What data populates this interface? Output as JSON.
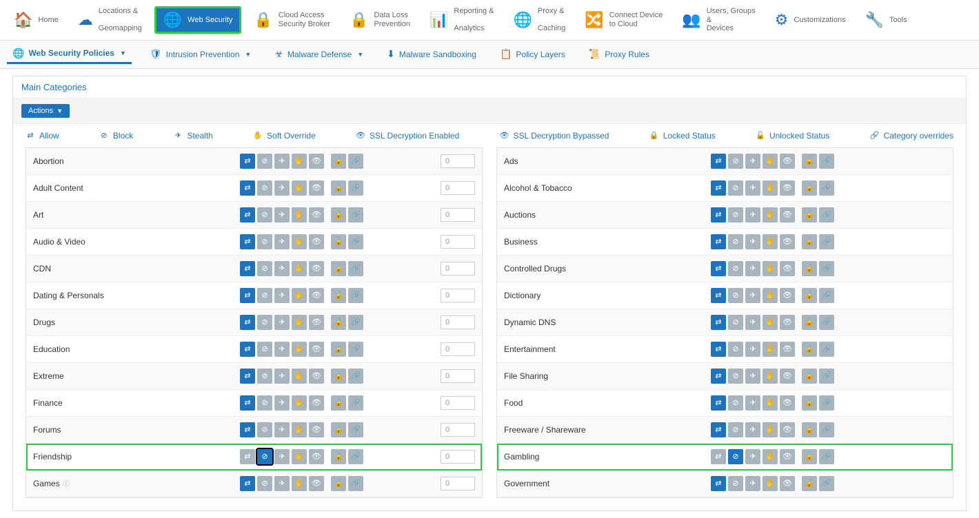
{
  "topnav": [
    {
      "label": "Home",
      "icon": "🏠"
    },
    {
      "label": "Locations & Geomapping",
      "icon": "☁"
    },
    {
      "label": "Web Security",
      "icon": "🌐",
      "active": true
    },
    {
      "label": "Cloud Access Security Broker",
      "icon": "🔒"
    },
    {
      "label": "Data Loss Prevention",
      "icon": "🔒"
    },
    {
      "label": "Reporting & Analytics",
      "icon": "📊"
    },
    {
      "label": "Proxy & Caching",
      "icon": "🌐"
    },
    {
      "label": "Connect Device to Cloud",
      "icon": "🔀"
    },
    {
      "label": "Users, Groups & Devices",
      "icon": "👥"
    },
    {
      "label": "Customizations",
      "icon": "⚙"
    },
    {
      "label": "Tools",
      "icon": "🔧"
    }
  ],
  "subnav": [
    {
      "label": "Web Security Policies",
      "icon": "🌐",
      "active": true,
      "dropdown": true
    },
    {
      "label": "Intrusion Prevention",
      "icon": "🛡",
      "dropdown": true
    },
    {
      "label": "Malware Defense",
      "icon": "☣",
      "dropdown": true
    },
    {
      "label": "Malware Sandboxing",
      "icon": "⬇"
    },
    {
      "label": "Policy Layers",
      "icon": "📋"
    },
    {
      "label": "Proxy Rules",
      "icon": "📜"
    }
  ],
  "panel_title": "Main Categories",
  "actions_label": "Actions",
  "legend": [
    {
      "label": "Allow",
      "icon": "⇄"
    },
    {
      "label": "Block",
      "icon": "⊘"
    },
    {
      "label": "Stealth",
      "icon": "✈"
    },
    {
      "label": "Soft Override",
      "icon": "✋"
    },
    {
      "label": "SSL Decryption Enabled",
      "icon": "👁"
    },
    {
      "label": "SSL Decryption Bypassed",
      "icon": "👁"
    },
    {
      "label": "Locked Status",
      "icon": "🔒"
    },
    {
      "label": "Unlocked Status",
      "icon": "🔓"
    },
    {
      "label": "Category overrides",
      "icon": "🔗"
    }
  ],
  "toggle_icons": [
    "⇄",
    "⊘",
    "✈",
    "✋",
    "👁",
    "🔓",
    "🔗"
  ],
  "left_categories": [
    {
      "name": "Abortion",
      "states": [
        "on",
        "off",
        "off",
        "off",
        "off",
        "off",
        "off"
      ],
      "count": "0"
    },
    {
      "name": "Adult Content",
      "states": [
        "on",
        "off",
        "off",
        "off",
        "off",
        "off",
        "off"
      ],
      "count": "0"
    },
    {
      "name": "Art",
      "states": [
        "on",
        "off",
        "off",
        "off",
        "off",
        "off",
        "off"
      ],
      "count": "0"
    },
    {
      "name": "Audio & Video",
      "states": [
        "on",
        "off",
        "off",
        "off",
        "off",
        "off",
        "off"
      ],
      "count": "0"
    },
    {
      "name": "CDN",
      "states": [
        "on",
        "off",
        "off",
        "off",
        "off",
        "off",
        "off"
      ],
      "count": "0"
    },
    {
      "name": "Dating & Personals",
      "states": [
        "on",
        "off",
        "off",
        "off",
        "off",
        "off",
        "off"
      ],
      "count": "0"
    },
    {
      "name": "Drugs",
      "states": [
        "on",
        "off",
        "off",
        "off",
        "off",
        "off",
        "off"
      ],
      "count": "0"
    },
    {
      "name": "Education",
      "states": [
        "on",
        "off",
        "off",
        "off",
        "off",
        "off",
        "off"
      ],
      "count": "0"
    },
    {
      "name": "Extreme",
      "states": [
        "on",
        "off",
        "off",
        "off",
        "off",
        "off",
        "off"
      ],
      "count": "0"
    },
    {
      "name": "Finance",
      "states": [
        "on",
        "off",
        "off",
        "off",
        "off",
        "off",
        "off"
      ],
      "count": "0"
    },
    {
      "name": "Forums",
      "states": [
        "on",
        "off",
        "off",
        "off",
        "off",
        "off",
        "off"
      ],
      "count": "0"
    },
    {
      "name": "Friendship",
      "states": [
        "off",
        "on",
        "off",
        "off",
        "off",
        "off",
        "off"
      ],
      "count": "0",
      "highlight": true,
      "selected_idx": 1
    },
    {
      "name": "Games",
      "states": [
        "on",
        "off",
        "off",
        "off",
        "off",
        "off",
        "off"
      ],
      "count": "0",
      "info": true
    }
  ],
  "right_categories": [
    {
      "name": "Ads",
      "states": [
        "on",
        "off",
        "off",
        "off",
        "off",
        "off",
        "off"
      ]
    },
    {
      "name": "Alcohol & Tobacco",
      "states": [
        "on",
        "off",
        "off",
        "off",
        "off",
        "off",
        "off"
      ]
    },
    {
      "name": "Auctions",
      "states": [
        "on",
        "off",
        "off",
        "off",
        "off",
        "off",
        "off"
      ]
    },
    {
      "name": "Business",
      "states": [
        "on",
        "off",
        "off",
        "off",
        "off",
        "off",
        "off"
      ]
    },
    {
      "name": "Controlled Drugs",
      "states": [
        "on",
        "off",
        "off",
        "off",
        "off",
        "off",
        "off"
      ]
    },
    {
      "name": "Dictionary",
      "states": [
        "on",
        "off",
        "off",
        "off",
        "off",
        "off",
        "off"
      ]
    },
    {
      "name": "Dynamic DNS",
      "states": [
        "on",
        "off",
        "off",
        "off",
        "off",
        "off",
        "off"
      ]
    },
    {
      "name": "Entertainment",
      "states": [
        "on",
        "off",
        "off",
        "off",
        "off",
        "off",
        "off"
      ]
    },
    {
      "name": "File Sharing",
      "states": [
        "on",
        "off",
        "off",
        "off",
        "off",
        "off",
        "off"
      ]
    },
    {
      "name": "Food",
      "states": [
        "on",
        "off",
        "off",
        "off",
        "off",
        "off",
        "off"
      ]
    },
    {
      "name": "Freeware / Shareware",
      "states": [
        "on",
        "off",
        "off",
        "off",
        "off",
        "off",
        "off"
      ]
    },
    {
      "name": "Gambling",
      "states": [
        "off",
        "on",
        "off",
        "off",
        "off",
        "off",
        "off"
      ],
      "highlight": true
    },
    {
      "name": "Government",
      "states": [
        "on",
        "off",
        "off",
        "off",
        "off",
        "off",
        "off"
      ]
    }
  ]
}
